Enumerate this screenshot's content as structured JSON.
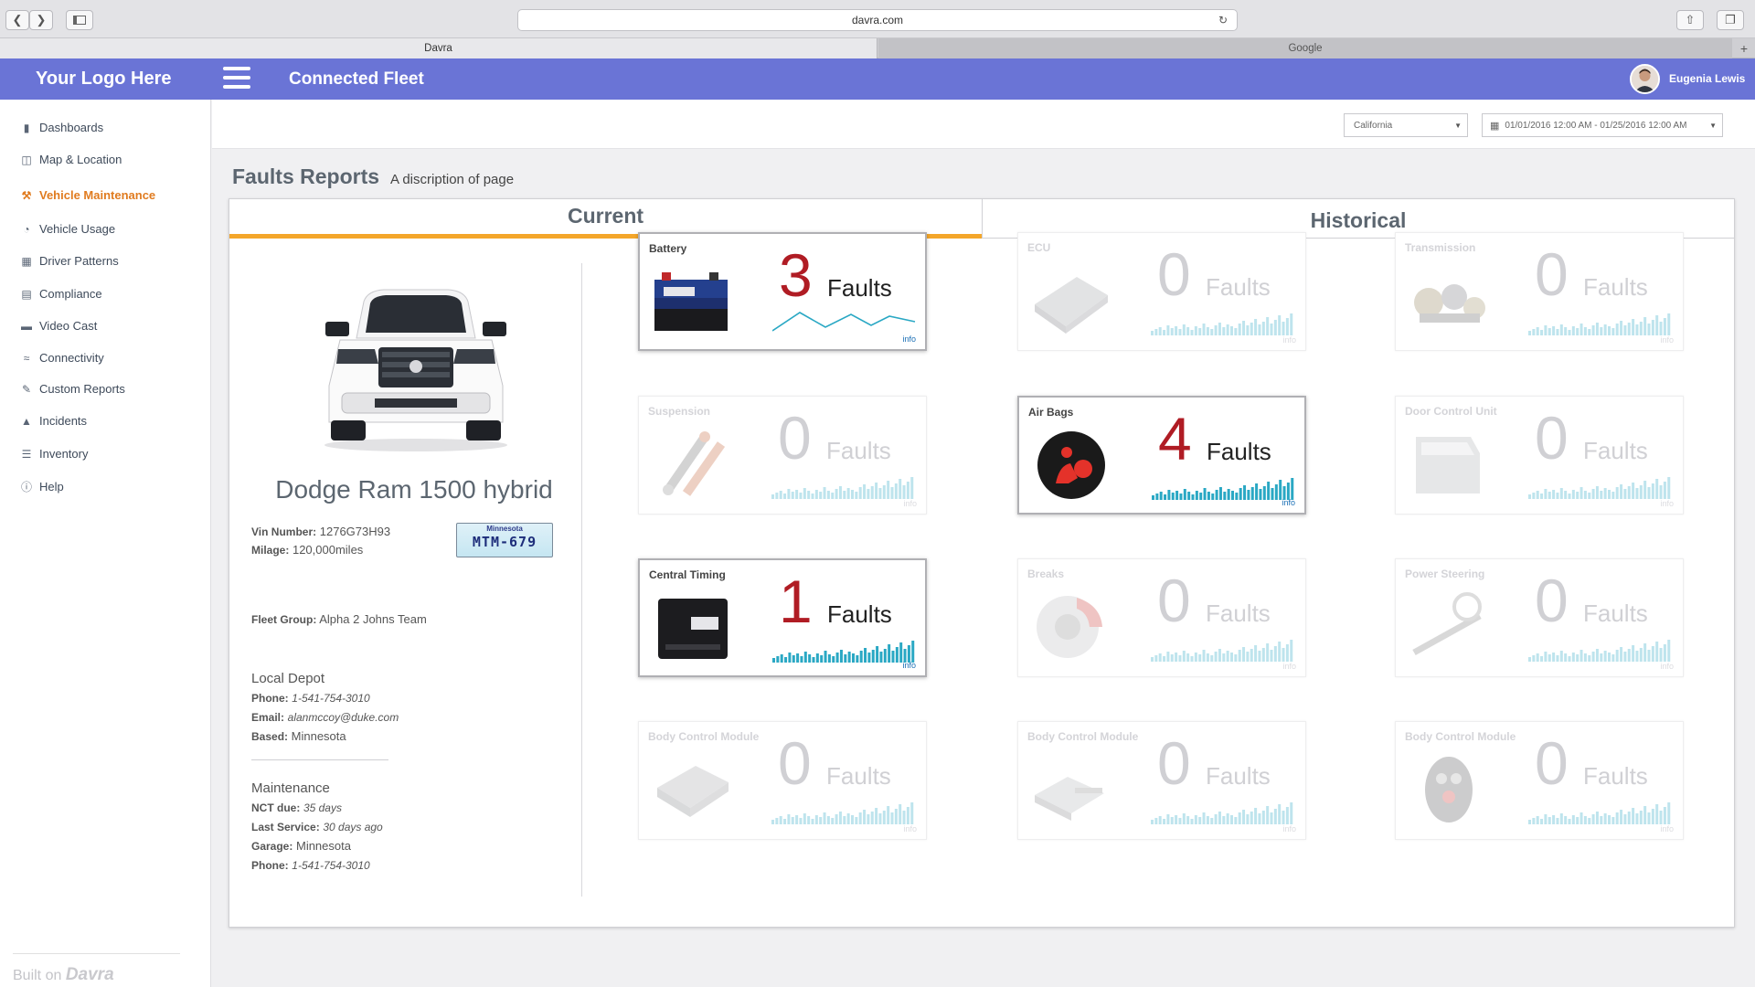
{
  "browser": {
    "url": "davra.com",
    "tabs": [
      {
        "label": "Davra"
      },
      {
        "label": "Google"
      }
    ]
  },
  "app": {
    "logo": "Your Logo Here",
    "title": "Connected Fleet",
    "user": "Eugenia Lewis"
  },
  "sidebar": {
    "items": [
      {
        "label": "Dashboards",
        "icon": "chart-icon"
      },
      {
        "label": "Map & Location",
        "icon": "map-icon"
      },
      {
        "label": "Vehicle Maintenance",
        "icon": "wrench-icon"
      },
      {
        "label": "Vehicle Usage",
        "icon": "pie-icon"
      },
      {
        "label": "Driver Patterns",
        "icon": "id-card-icon"
      },
      {
        "label": "Compliance",
        "icon": "document-icon"
      },
      {
        "label": "Video Cast",
        "icon": "video-icon"
      },
      {
        "label": "Connectivity",
        "icon": "wifi-icon"
      },
      {
        "label": "Custom Reports",
        "icon": "edit-icon"
      },
      {
        "label": "Incidents",
        "icon": "warning-icon"
      },
      {
        "label": "Inventory",
        "icon": "list-icon"
      },
      {
        "label": "Help",
        "icon": "info-icon"
      }
    ],
    "footer_prefix": "Built on",
    "footer_brand": "Davra"
  },
  "filters": {
    "region": "California",
    "date_range": "01/01/2016 12:00 AM - 01/25/2016 12:00 AM"
  },
  "page": {
    "title": "Faults Reports",
    "description": "A discription of page"
  },
  "tabs": {
    "current": "Current",
    "historical": "Historical"
  },
  "vehicle": {
    "name": "Dodge Ram 1500 hybrid",
    "vin_label": "Vin Number:",
    "vin": "1276G73H93",
    "milage_label": "Milage:",
    "milage": "120,000miles",
    "plate_state": "Minnesota",
    "plate_number": "MTM-679",
    "fleet_label": "Fleet Group:",
    "fleet": "Alpha 2  Johns Team",
    "depot_heading": "Local Depot",
    "depot_phone_label": "Phone:",
    "depot_phone": "1-541-754-3010",
    "depot_email_label": "Email:",
    "depot_email": "alanmccoy@duke.com",
    "depot_based_label": "Based:",
    "depot_based": "Minnesota",
    "maint_heading": "Maintenance",
    "nct_label": "NCT due:",
    "nct": "35 days",
    "last_service_label": "Last Service:",
    "last_service": "30 days ago",
    "garage_label": "Garage:",
    "garage": "Minnesota",
    "maint_phone_label": "Phone:",
    "maint_phone": "1-541-754-3010"
  },
  "faults_word": "Faults",
  "info_word": "info",
  "cards": [
    {
      "title": "Battery",
      "count": "3",
      "active": true,
      "spark": "line",
      "thumb": "battery"
    },
    {
      "title": "ECU",
      "count": "0",
      "active": false,
      "spark": "bars",
      "thumb": "ecu"
    },
    {
      "title": "Transmission",
      "count": "0",
      "active": false,
      "spark": "bars",
      "thumb": "transmission"
    },
    {
      "title": "Suspension",
      "count": "0",
      "active": false,
      "spark": "bars",
      "thumb": "suspension"
    },
    {
      "title": "Air Bags",
      "count": "4",
      "active": true,
      "spark": "bars",
      "thumb": "airbag"
    },
    {
      "title": "Door Control Unit",
      "count": "0",
      "active": false,
      "spark": "bars",
      "thumb": "door"
    },
    {
      "title": "Central Timing",
      "count": "1",
      "active": true,
      "spark": "bars",
      "thumb": "timing"
    },
    {
      "title": "Breaks",
      "count": "0",
      "active": false,
      "spark": "bars",
      "thumb": "brake"
    },
    {
      "title": "Power Steering",
      "count": "0",
      "active": false,
      "spark": "bars",
      "thumb": "steering"
    },
    {
      "title": "Body Control Module",
      "count": "0",
      "active": false,
      "spark": "bars",
      "thumb": "module"
    },
    {
      "title": "Body Control Module",
      "count": "0",
      "active": false,
      "spark": "bars",
      "thumb": "module2"
    },
    {
      "title": "Body Control Module",
      "count": "0",
      "active": false,
      "spark": "bars",
      "thumb": "keyfob"
    }
  ],
  "colors": {
    "header": "#6a74d6",
    "accent_tab": "#f4a62a",
    "active_nav": "#e07b1f",
    "fault_count": "#b01c24",
    "spark": "#2aa8c4"
  }
}
